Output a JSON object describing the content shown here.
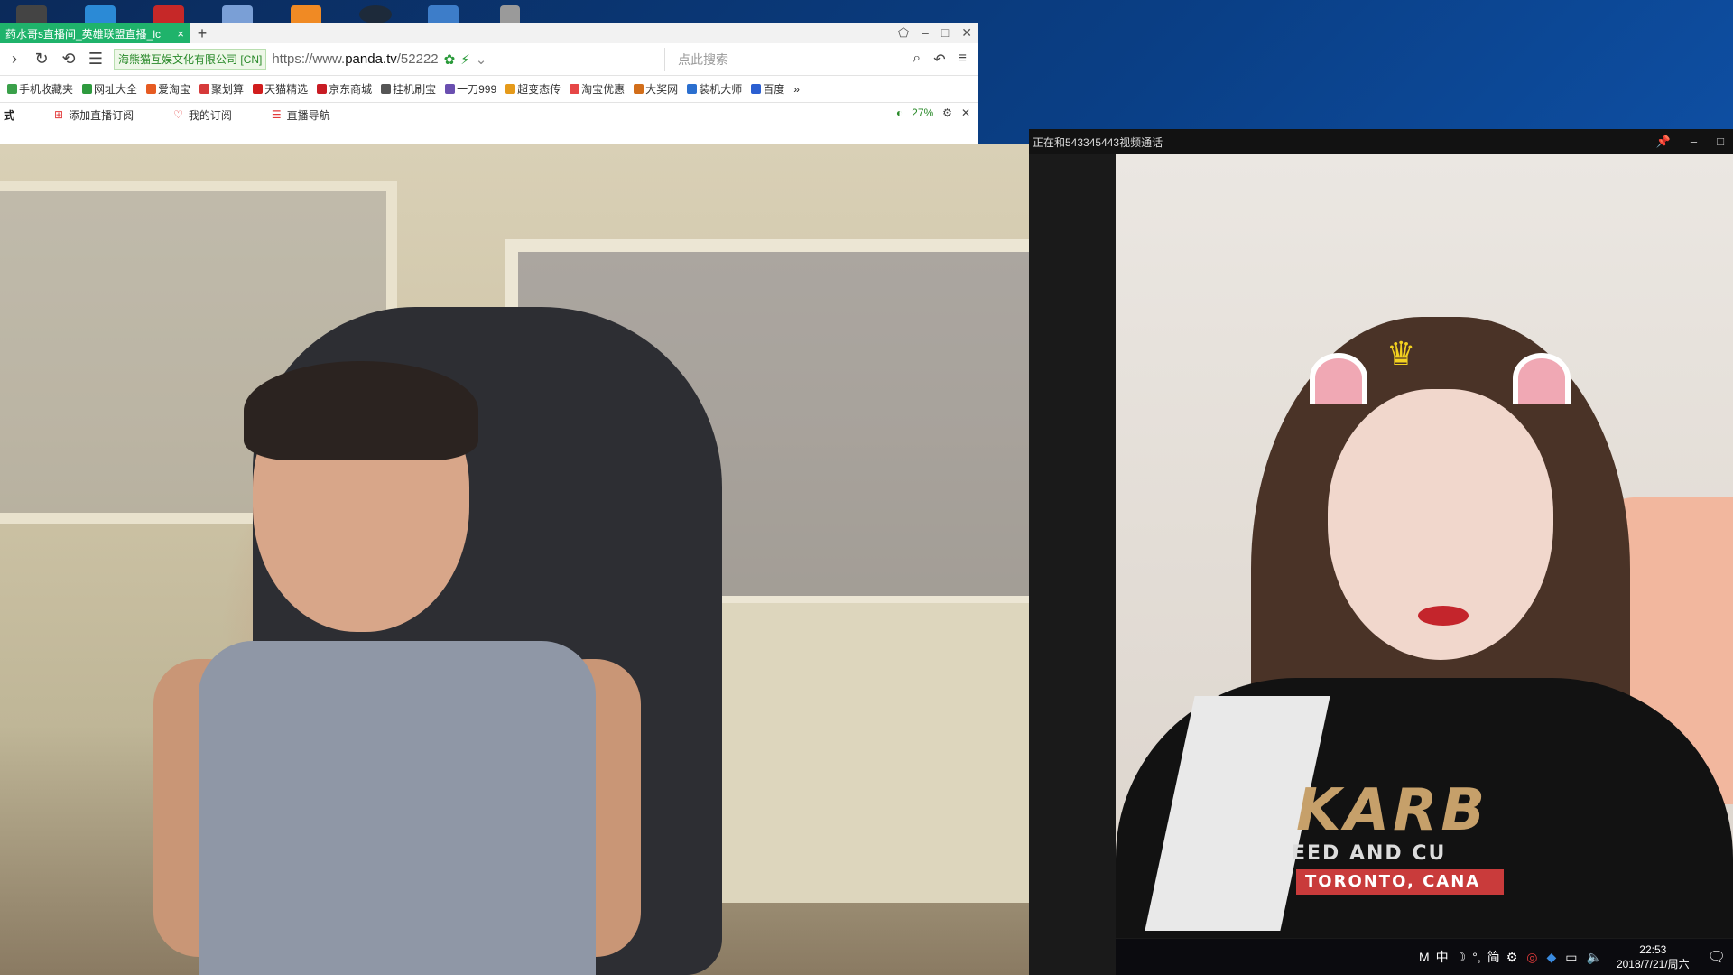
{
  "browser": {
    "tab_title": "药水哥s直播间_英雄联盟直播_lc",
    "tab_close": "×",
    "new_tab": "+",
    "url_cert": "海熊猫互娱文化有限公司 [CN]",
    "url_prefix": "https://www.",
    "url_domain": "panda.tv",
    "url_path": "/52222",
    "search_placeholder": "点此搜索"
  },
  "bookmarks": [
    {
      "label": "手机收藏夹",
      "color": "#3aa04a"
    },
    {
      "label": "网址大全",
      "color": "#2e9a3e"
    },
    {
      "label": "爱淘宝",
      "color": "#e65b22"
    },
    {
      "label": "聚划算",
      "color": "#d63a3a"
    },
    {
      "label": "天猫精选",
      "color": "#d11d1d"
    },
    {
      "label": "京东商城",
      "color": "#c81c24"
    },
    {
      "label": "挂机刷宝",
      "color": "#555555"
    },
    {
      "label": "一刀999",
      "color": "#6a4fb0"
    },
    {
      "label": "超变态传",
      "color": "#e59a1a"
    },
    {
      "label": "淘宝优惠",
      "color": "#e64646"
    },
    {
      "label": "大奖网",
      "color": "#d26e1a"
    },
    {
      "label": "装机大师",
      "color": "#2b6fcf"
    },
    {
      "label": "百度",
      "color": "#2b5fd1"
    }
  ],
  "bookmarks_more": "»",
  "ext_bar": {
    "left_label": "式",
    "add_sub": "添加直播订阅",
    "my_sub": "我的订阅",
    "nav": "直播导航",
    "percent": "27%"
  },
  "call": {
    "title": "正在和543345443视频通话"
  },
  "hoodie": {
    "main": "KARB",
    "sub": "EED AND CU",
    "band": "TORONTO, CANA"
  },
  "taskbar": {
    "tray_text": [
      "M",
      "中",
      "☽",
      "°,",
      "简",
      "⚙"
    ],
    "time": "22:53",
    "date": "2018/7/21/周六"
  },
  "colors": {
    "tab_green": "#1fb36b",
    "desktop_blue": "#0a3f86"
  }
}
